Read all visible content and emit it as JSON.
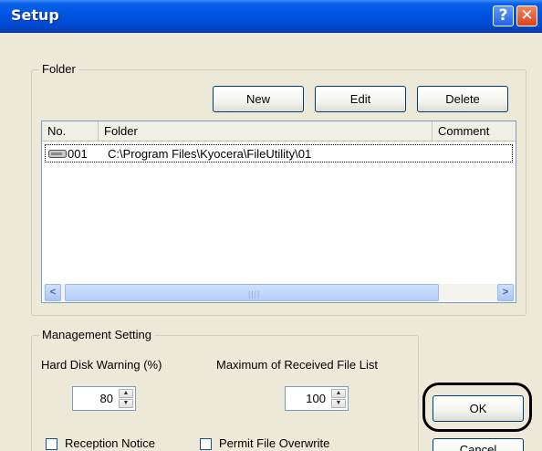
{
  "window": {
    "title": "Setup",
    "help_glyph": "?",
    "close_glyph": "✕"
  },
  "folder_group": {
    "label": "Folder",
    "buttons": {
      "new": "New",
      "edit": "Edit",
      "delete": "Delete"
    },
    "columns": [
      "No.",
      "Folder",
      "Comment"
    ],
    "rows": [
      {
        "no": "001",
        "folder": "C:\\Program Files\\Kyocera\\FileUtility\\01",
        "comment": "",
        "icon": "drive-icon"
      }
    ],
    "scroll_left": "<",
    "scroll_right": ">",
    "scroll_grip": "||||"
  },
  "management_group": {
    "label": "Management Setting",
    "hard_disk_label": "Hard Disk Warning (%)",
    "hard_disk_value": "80",
    "max_list_label": "Maximum of Received File List",
    "max_list_value": "100",
    "reception_notice": "Reception Notice",
    "permit_overwrite": "Permit File Overwrite",
    "spin_up": "▲",
    "spin_down": "▼"
  },
  "dialog_buttons": {
    "ok": "OK",
    "cancel": "Cancel"
  },
  "colors": {
    "title_bar": "#0054e3",
    "window_bg": "#ece9d8",
    "highlight_ring": "#000000"
  }
}
